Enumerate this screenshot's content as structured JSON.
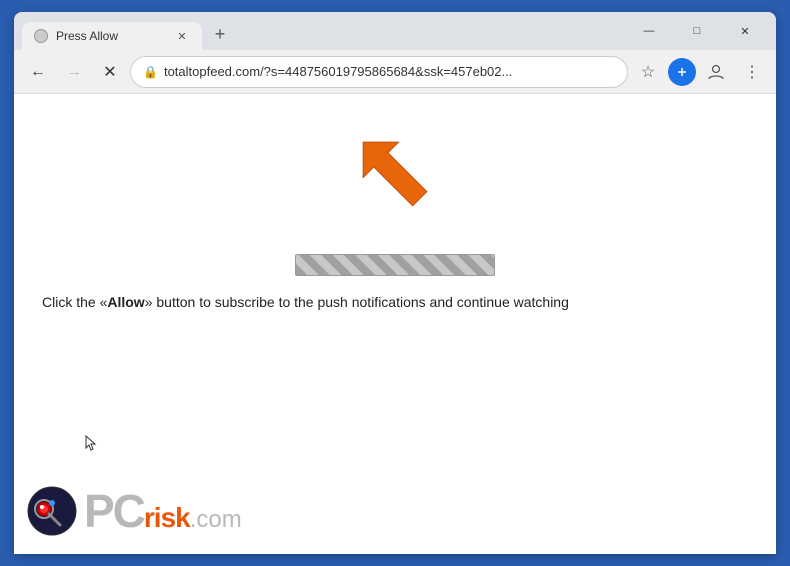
{
  "browser": {
    "title": "Press Allow",
    "tab_label": "Press Allow",
    "new_tab_label": "+",
    "url": "totaltopfeed.com/?s=448756019795865684&ssk=457eb02...",
    "window_controls": {
      "minimize": "—",
      "maximize": "□",
      "close": "✕"
    }
  },
  "toolbar": {
    "back_label": "←",
    "forward_label": "→",
    "reload_label": "✕",
    "lock_label": "🔒"
  },
  "content": {
    "message": "Click the «Allow» button to subscribe to the push notifications and continue watching",
    "message_bold": "Allow"
  },
  "logo": {
    "pc_text": "PC",
    "risk_text": "risk",
    "com_text": ".com"
  },
  "icons": {
    "star": "☆",
    "profile": "👤",
    "menu": "⋮",
    "extension": "⊕"
  }
}
